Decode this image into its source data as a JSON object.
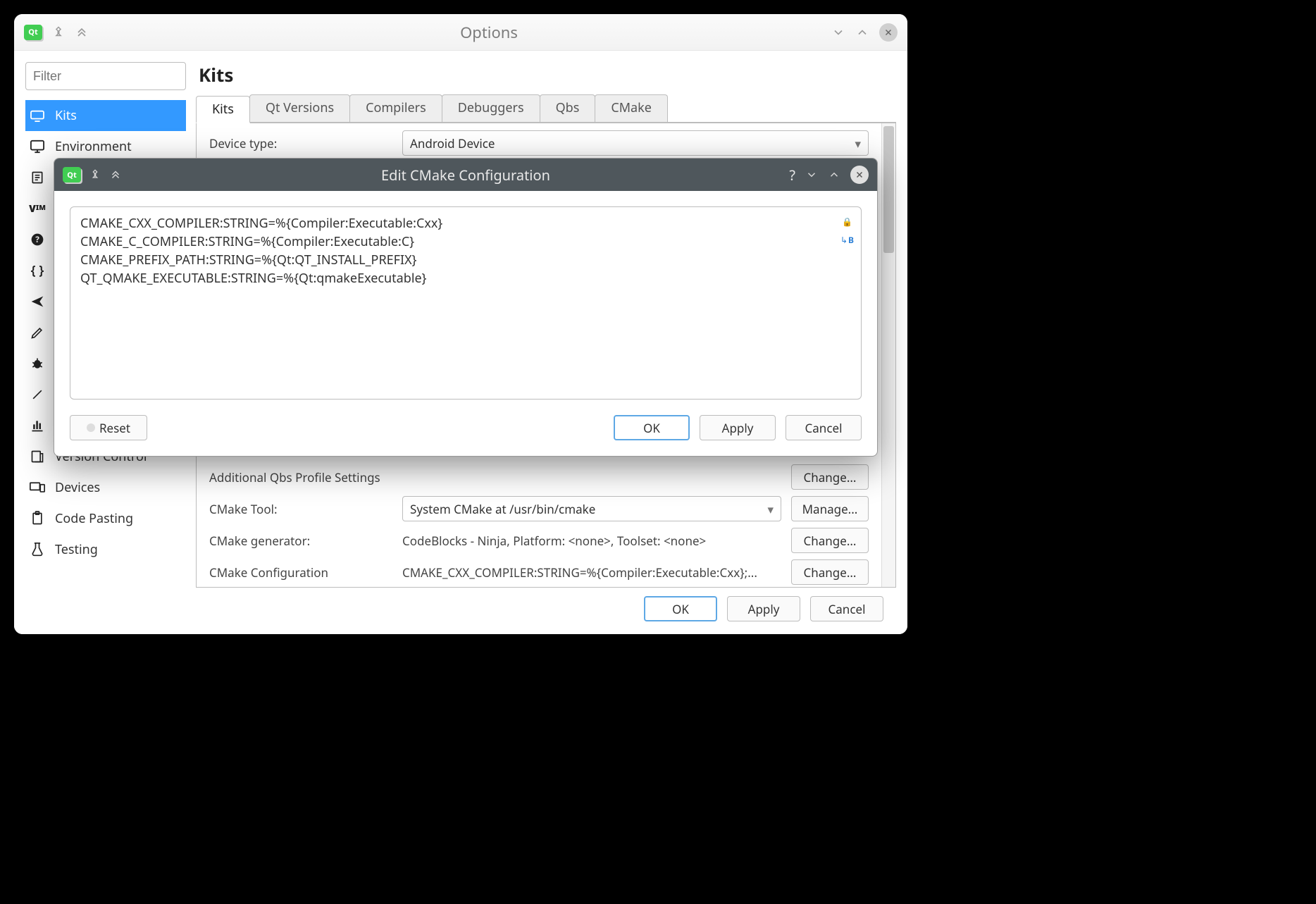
{
  "options_window": {
    "title": "Options",
    "filter_placeholder": "Filter",
    "categories": [
      "Kits",
      "Environment",
      "",
      "",
      "",
      "",
      "",
      "",
      "",
      "",
      "Version Control",
      "Devices",
      "Code Pasting",
      "Testing"
    ],
    "selected_category": "Kits",
    "page_title": "Kits",
    "tabs": [
      "Kits",
      "Qt Versions",
      "Compilers",
      "Debuggers",
      "Qbs",
      "CMake"
    ],
    "active_tab": "Kits",
    "device_type": {
      "label": "Device type:",
      "value": "Android Device"
    },
    "qbs_profile": {
      "label": "Additional Qbs Profile Settings",
      "button": "Change..."
    },
    "cmake_tool": {
      "label": "CMake Tool:",
      "value": "System CMake at /usr/bin/cmake",
      "button": "Manage..."
    },
    "cmake_generator": {
      "label": "CMake generator:",
      "value": "CodeBlocks - Ninja, Platform: <none>, Toolset: <none>",
      "button": "Change..."
    },
    "cmake_config": {
      "label": "CMake Configuration",
      "value": "CMAKE_CXX_COMPILER:STRING=%{Compiler:Executable:Cxx};...",
      "button": "Change..."
    },
    "footer": {
      "ok": "OK",
      "apply": "Apply",
      "cancel": "Cancel"
    }
  },
  "modal": {
    "title": "Edit CMake Configuration",
    "lines": [
      "CMAKE_CXX_COMPILER:STRING=%{Compiler:Executable:Cxx}",
      "CMAKE_C_COMPILER:STRING=%{Compiler:Executable:C}",
      "CMAKE_PREFIX_PATH:STRING=%{Qt:QT_INSTALL_PREFIX}",
      "QT_QMAKE_EXECUTABLE:STRING=%{Qt:qmakeExecutable}"
    ],
    "reset": "Reset",
    "ok": "OK",
    "apply": "Apply",
    "cancel": "Cancel"
  }
}
